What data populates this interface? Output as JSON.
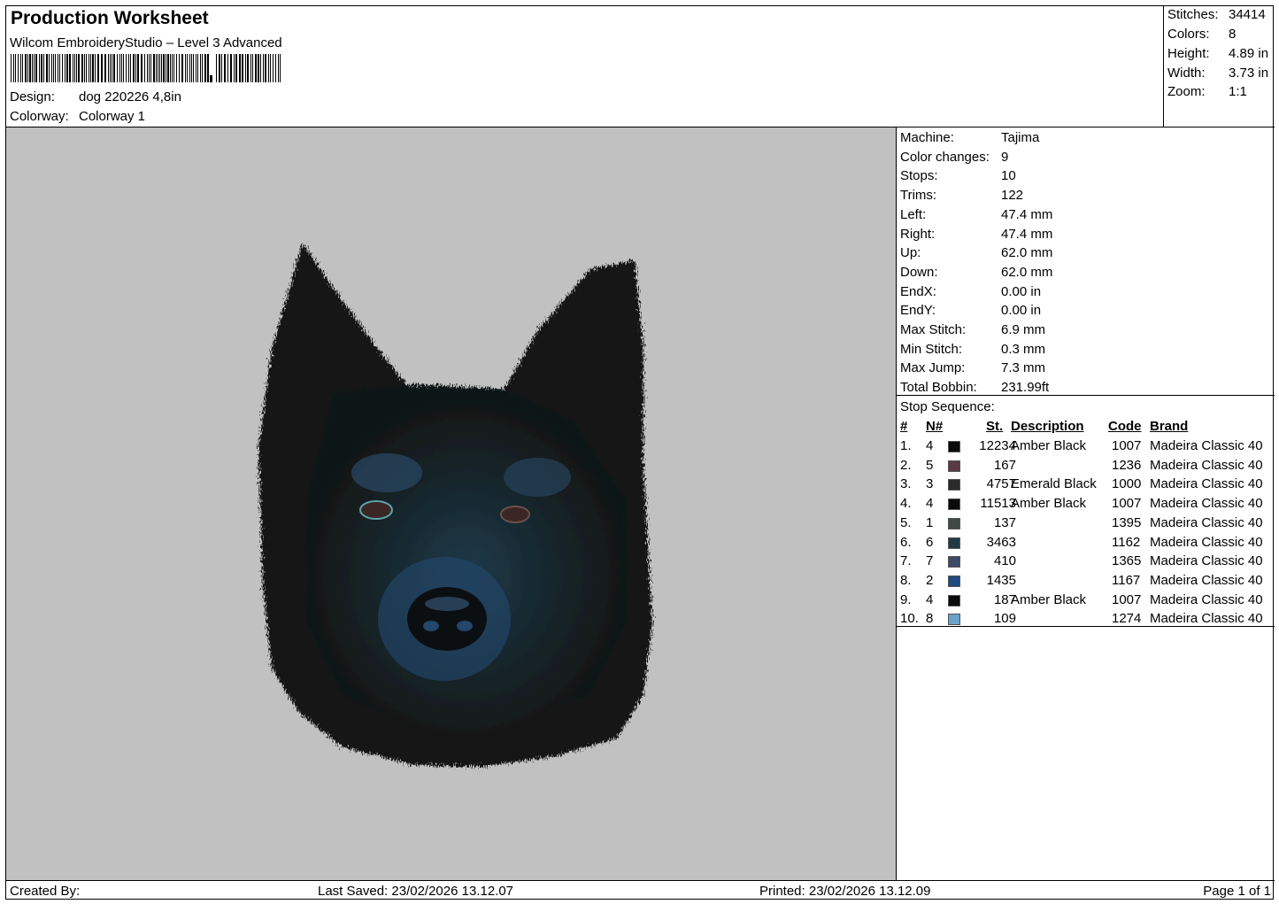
{
  "header": {
    "title": "Production Worksheet",
    "software": "Wilcom EmbroideryStudio – Level 3 Advanced",
    "design_label": "Design:",
    "design_value": "dog 220226 4,8in",
    "colorway_label": "Colorway:",
    "colorway_value": "Colorway 1"
  },
  "stats": [
    {
      "label": "Stitches:",
      "value": "34414"
    },
    {
      "label": "Colors:",
      "value": "8"
    },
    {
      "label": "Height:",
      "value": "4.89 in"
    },
    {
      "label": "Width:",
      "value": "3.73 in"
    },
    {
      "label": "Zoom:",
      "value": "1:1"
    }
  ],
  "info": [
    {
      "label": "Machine:",
      "value": "Tajima"
    },
    {
      "label": "Color changes:",
      "value": "9"
    },
    {
      "label": "Stops:",
      "value": "10"
    },
    {
      "label": "Trims:",
      "value": "122"
    },
    {
      "label": "Left:",
      "value": "47.4 mm"
    },
    {
      "label": "Right:",
      "value": "47.4 mm"
    },
    {
      "label": "Up:",
      "value": "62.0 mm"
    },
    {
      "label": "Down:",
      "value": "62.0 mm"
    },
    {
      "label": "EndX:",
      "value": "0.00 in"
    },
    {
      "label": "EndY:",
      "value": "0.00 in"
    },
    {
      "label": "Max Stitch:",
      "value": "6.9 mm"
    },
    {
      "label": "Min Stitch:",
      "value": "0.3 mm"
    },
    {
      "label": "Max Jump:",
      "value": "7.3 mm"
    },
    {
      "label": "Total Bobbin:",
      "value": "231.99ft"
    }
  ],
  "stop_sequence": {
    "title": "Stop Sequence:",
    "headers": {
      "num": "#",
      "n": "N#",
      "st": "St.",
      "description": "Description",
      "code": "Code",
      "brand": "Brand"
    },
    "rows": [
      {
        "num": "1.",
        "n": "4",
        "color": "#0b0b0b",
        "st": "12234",
        "description": "Amber Black",
        "code": "1007",
        "brand": "Madeira Classic 40"
      },
      {
        "num": "2.",
        "n": "5",
        "color": "#5a3a44",
        "st": "167",
        "description": "",
        "code": "1236",
        "brand": "Madeira Classic 40"
      },
      {
        "num": "3.",
        "n": "3",
        "color": "#2b2b2b",
        "st": "4757",
        "description": "Emerald Black",
        "code": "1000",
        "brand": "Madeira Classic 40"
      },
      {
        "num": "4.",
        "n": "4",
        "color": "#0b0b0b",
        "st": "11513",
        "description": "Amber Black",
        "code": "1007",
        "brand": "Madeira Classic 40"
      },
      {
        "num": "5.",
        "n": "1",
        "color": "#3e4a46",
        "st": "137",
        "description": "",
        "code": "1395",
        "brand": "Madeira Classic 40"
      },
      {
        "num": "6.",
        "n": "6",
        "color": "#1e3a44",
        "st": "3463",
        "description": "",
        "code": "1162",
        "brand": "Madeira Classic 40"
      },
      {
        "num": "7.",
        "n": "7",
        "color": "#3c4a66",
        "st": "410",
        "description": "",
        "code": "1365",
        "brand": "Madeira Classic 40"
      },
      {
        "num": "8.",
        "n": "2",
        "color": "#1f4a80",
        "st": "1435",
        "description": "",
        "code": "1167",
        "brand": "Madeira Classic 40"
      },
      {
        "num": "9.",
        "n": "4",
        "color": "#0b0b0b",
        "st": "187",
        "description": "Amber Black",
        "code": "1007",
        "brand": "Madeira Classic 40"
      },
      {
        "num": "10.",
        "n": "8",
        "color": "#6aa2c8",
        "st": "109",
        "description": "",
        "code": "1274",
        "brand": "Madeira Classic 40"
      }
    ]
  },
  "footer": {
    "created_by": "Created By:",
    "last_saved": "Last Saved: 23/02/2026 13.12.07",
    "printed": "Printed: 23/02/2026 13.12.09",
    "page": "Page 1 of 1"
  }
}
